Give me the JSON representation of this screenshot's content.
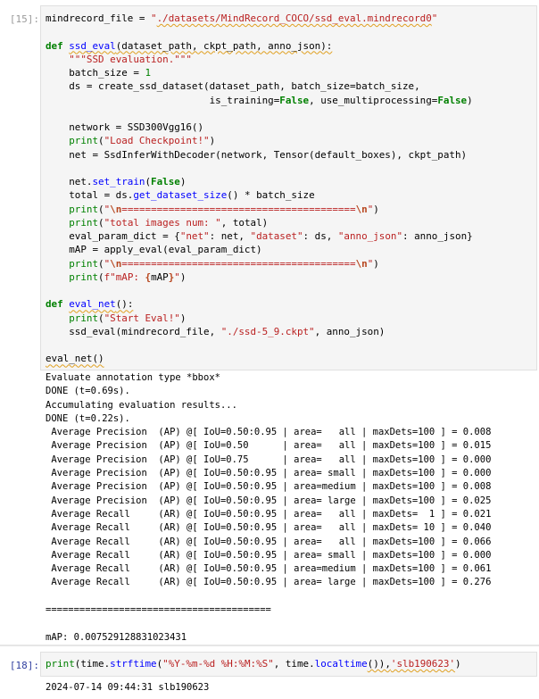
{
  "cell15": {
    "prompt": "[15]:",
    "lines": [
      [
        "mindrecord_file = ",
        "./datasets/MindRecord_COCO/ssd_eval.mindrecord0"
      ],
      [
        "def",
        "ssd_eval",
        "(dataset_path, ckpt_path, anno_json):"
      ],
      [
        "    ",
        "\"\"\"SSD evaluation.\"\"\""
      ],
      [
        "    batch_size = ",
        "1"
      ],
      [
        "    ds = create_ssd_dataset(dataset_path, batch_size=batch_size,"
      ],
      [
        "                            is_training=",
        "False",
        ", use_multiprocessing=",
        "False",
        ")"
      ],
      [
        "    network = SSD300Vgg16()"
      ],
      [
        "    ",
        "print",
        "(",
        "\"Load Checkpoint!\"",
        ")"
      ],
      [
        "    net = SsdInferWithDecoder(network, Tensor(default_boxes), ckpt_path)"
      ],
      [
        "    net.",
        "set_train",
        "(",
        "False",
        ")"
      ],
      [
        "    total = ds.",
        "get_dataset_size",
        "() * batch_size"
      ],
      [
        "    ",
        "print",
        "(",
        "\"",
        "\\n",
        "========================================",
        "\\n",
        "\"",
        ")"
      ],
      [
        "    ",
        "print",
        "(",
        "\"total images num: \"",
        ", total)"
      ],
      [
        "    eval_param_dict = {",
        "\"net\"",
        ": net, ",
        "\"dataset\"",
        ": ds, ",
        "\"anno_json\"",
        ": anno_json}"
      ],
      [
        "    mAP = apply_eval(eval_param_dict)"
      ],
      [
        "    ",
        "print",
        "(",
        "\"",
        "\\n",
        "========================================",
        "\\n",
        "\"",
        ")"
      ],
      [
        "    ",
        "print",
        "(",
        "f\"mAP: ",
        "{",
        "mAP",
        "}",
        "\"",
        ")"
      ],
      [
        "def",
        "eval_net",
        "():"
      ],
      [
        "    ",
        "print",
        "(",
        "\"Start Eval!\"",
        ")"
      ],
      [
        "    ssd_eval(mindrecord_file, ",
        "\"./ssd-5_9.ckpt\"",
        ", anno_json)"
      ],
      [
        "eval_net()"
      ]
    ]
  },
  "output15": {
    "lines": [
      "Evaluate annotation type *bbox*",
      "DONE (t=0.69s).",
      "Accumulating evaluation results...",
      "DONE (t=0.22s).",
      " Average Precision  (AP) @[ IoU=0.50:0.95 | area=   all | maxDets=100 ] = 0.008",
      " Average Precision  (AP) @[ IoU=0.50      | area=   all | maxDets=100 ] = 0.015",
      " Average Precision  (AP) @[ IoU=0.75      | area=   all | maxDets=100 ] = 0.000",
      " Average Precision  (AP) @[ IoU=0.50:0.95 | area= small | maxDets=100 ] = 0.000",
      " Average Precision  (AP) @[ IoU=0.50:0.95 | area=medium | maxDets=100 ] = 0.008",
      " Average Precision  (AP) @[ IoU=0.50:0.95 | area= large | maxDets=100 ] = 0.025",
      " Average Recall     (AR) @[ IoU=0.50:0.95 | area=   all | maxDets=  1 ] = 0.021",
      " Average Recall     (AR) @[ IoU=0.50:0.95 | area=   all | maxDets= 10 ] = 0.040",
      " Average Recall     (AR) @[ IoU=0.50:0.95 | area=   all | maxDets=100 ] = 0.066",
      " Average Recall     (AR) @[ IoU=0.50:0.95 | area= small | maxDets=100 ] = 0.000",
      " Average Recall     (AR) @[ IoU=0.50:0.95 | area=medium | maxDets=100 ] = 0.061",
      " Average Recall     (AR) @[ IoU=0.50:0.95 | area= large | maxDets=100 ] = 0.276",
      "",
      "========================================",
      "",
      "mAP: 0.007529128831023431"
    ]
  },
  "cell18": {
    "prompt": "[18]:",
    "parts": [
      "print",
      "(time.",
      "strftime",
      "(",
      "\"%Y-%m-%d %H:%M:%S\"",
      ", time.",
      "localtime",
      "()),",
      "'slb190623'",
      ")"
    ]
  },
  "output18": {
    "text": "2024-07-14 09:44:31 slb190623"
  }
}
